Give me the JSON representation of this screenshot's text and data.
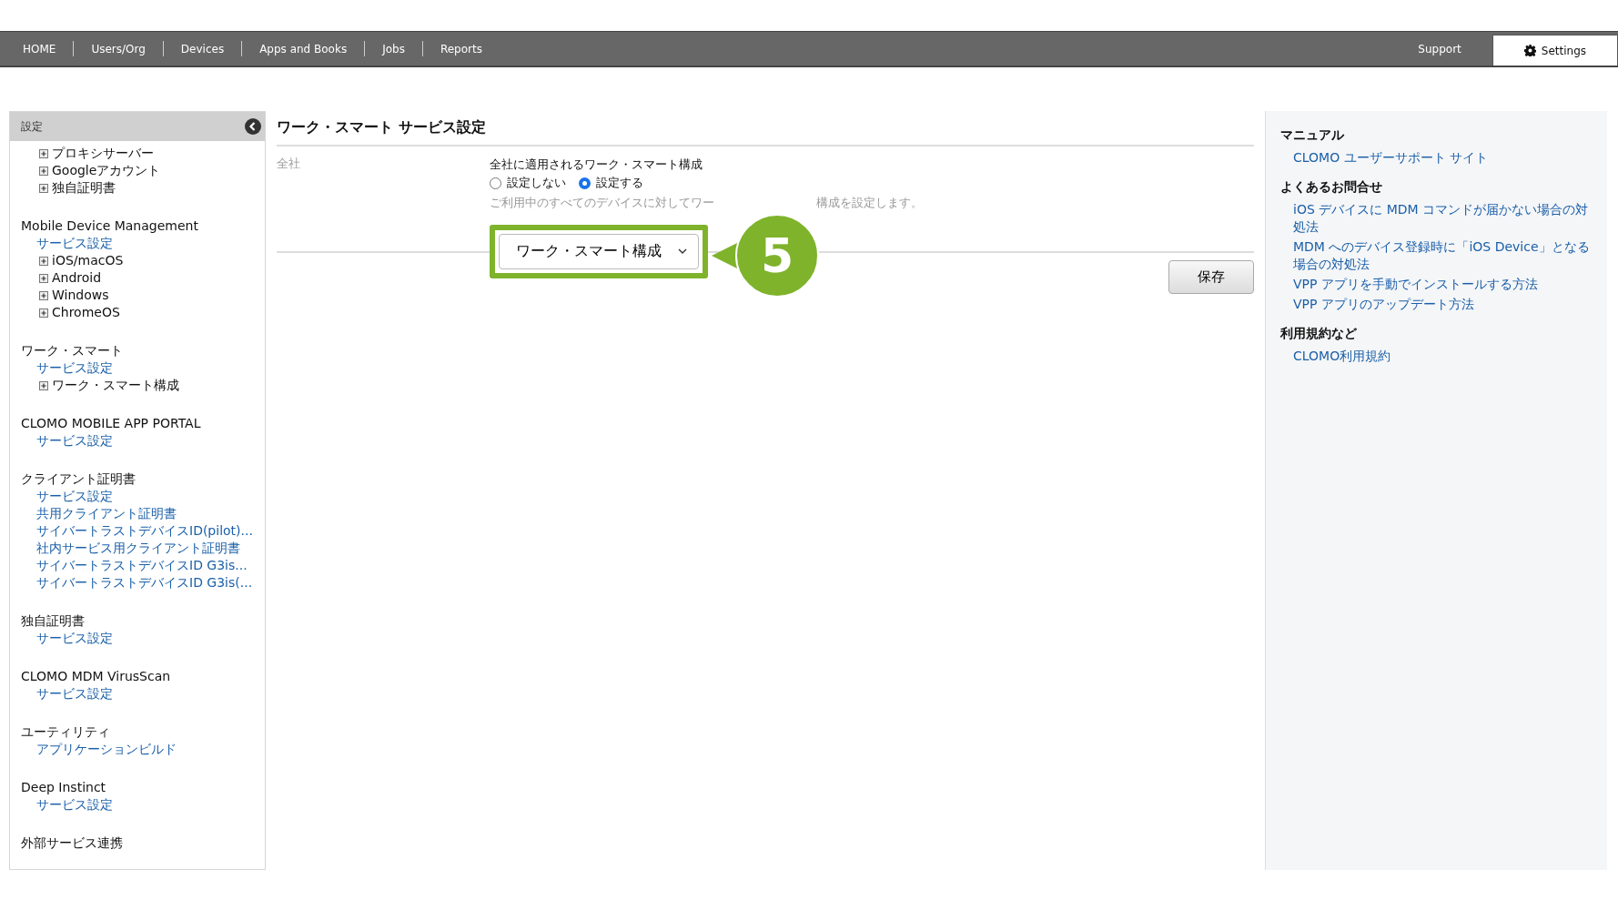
{
  "nav": {
    "items": [
      {
        "label": "HOME",
        "selected": false
      },
      {
        "label": "Users/Org",
        "selected": false
      },
      {
        "label": "Devices",
        "selected": false
      },
      {
        "label": "Apps and Books",
        "selected": false
      },
      {
        "label": "Jobs",
        "selected": false
      },
      {
        "label": "Reports",
        "selected": false
      }
    ],
    "right": [
      {
        "label": "Support",
        "selected": false,
        "kind": "text"
      },
      {
        "label": "Settings",
        "selected": true,
        "kind": "gear"
      }
    ]
  },
  "sidebar": {
    "title": "設定",
    "groups": [
      {
        "items": [
          {
            "kind": "tree",
            "label": "プロキシサーバー"
          },
          {
            "kind": "tree",
            "label": "Googleアカウント"
          },
          {
            "kind": "tree",
            "label": "独自証明書"
          }
        ]
      },
      {
        "title": "Mobile Device Management",
        "items": [
          {
            "kind": "link",
            "label": "サービス設定"
          },
          {
            "kind": "tree",
            "label": "iOS/macOS"
          },
          {
            "kind": "tree",
            "label": "Android"
          },
          {
            "kind": "tree",
            "label": "Windows"
          },
          {
            "kind": "tree",
            "label": "ChromeOS"
          }
        ]
      },
      {
        "title": "ワーク・スマート",
        "items": [
          {
            "kind": "link",
            "label": "サービス設定"
          },
          {
            "kind": "tree",
            "label": "ワーク・スマート構成"
          }
        ]
      },
      {
        "title": "CLOMO MOBILE APP PORTAL",
        "items": [
          {
            "kind": "link",
            "label": "サービス設定"
          }
        ]
      },
      {
        "title": "クライアント証明書",
        "items": [
          {
            "kind": "link",
            "label": "サービス設定"
          },
          {
            "kind": "link",
            "label": "共用クライアント証明書"
          },
          {
            "kind": "link",
            "label": "サイバートラストデバイスID(pilot)..."
          },
          {
            "kind": "link",
            "label": "社内サービス用クライアント証明書"
          },
          {
            "kind": "link",
            "label": "サイバートラストデバイスID G3is..."
          },
          {
            "kind": "link",
            "label": "サイバートラストデバイスID G3is(..."
          }
        ]
      },
      {
        "title": "独自証明書",
        "items": [
          {
            "kind": "link",
            "label": "サービス設定"
          }
        ]
      },
      {
        "title": "CLOMO MDM VirusScan",
        "items": [
          {
            "kind": "link",
            "label": "サービス設定"
          }
        ]
      },
      {
        "title": "ユーティリティ",
        "items": [
          {
            "kind": "link",
            "label": "アプリケーションビルド"
          }
        ]
      },
      {
        "title": "Deep Instinct",
        "items": [
          {
            "kind": "link",
            "label": "サービス設定"
          }
        ]
      },
      {
        "title": "外部サービス連携"
      }
    ]
  },
  "main": {
    "title": "ワーク・スマート サービス設定",
    "row_label": "全社",
    "field_label": "全社に適用されるワーク・スマート構成",
    "options": [
      {
        "label": "設定しない",
        "selected": false
      },
      {
        "label": "設定する",
        "selected": true
      }
    ],
    "hint_parts": [
      "ご利用中のすべてのデバイスに対してワー",
      "構成を設定します。"
    ],
    "select": {
      "value": "ワーク・スマート構成"
    },
    "callout": "5",
    "save": "保存"
  },
  "help": {
    "sections": [
      {
        "title": "マニュアル",
        "links": [
          "CLOMO ユーザーサポート サイト"
        ]
      },
      {
        "title": "よくあるお問合せ",
        "links": [
          "iOS デバイスに MDM コマンドが届かない場合の対処法",
          "MDM へのデバイス登録時に「iOS Device」となる場合の対処法",
          "VPP アプリを手動でインストールする方法",
          "VPP アプリのアップデート方法"
        ]
      },
      {
        "title": "利用規約など",
        "links": [
          "CLOMO利用規約"
        ]
      }
    ]
  }
}
